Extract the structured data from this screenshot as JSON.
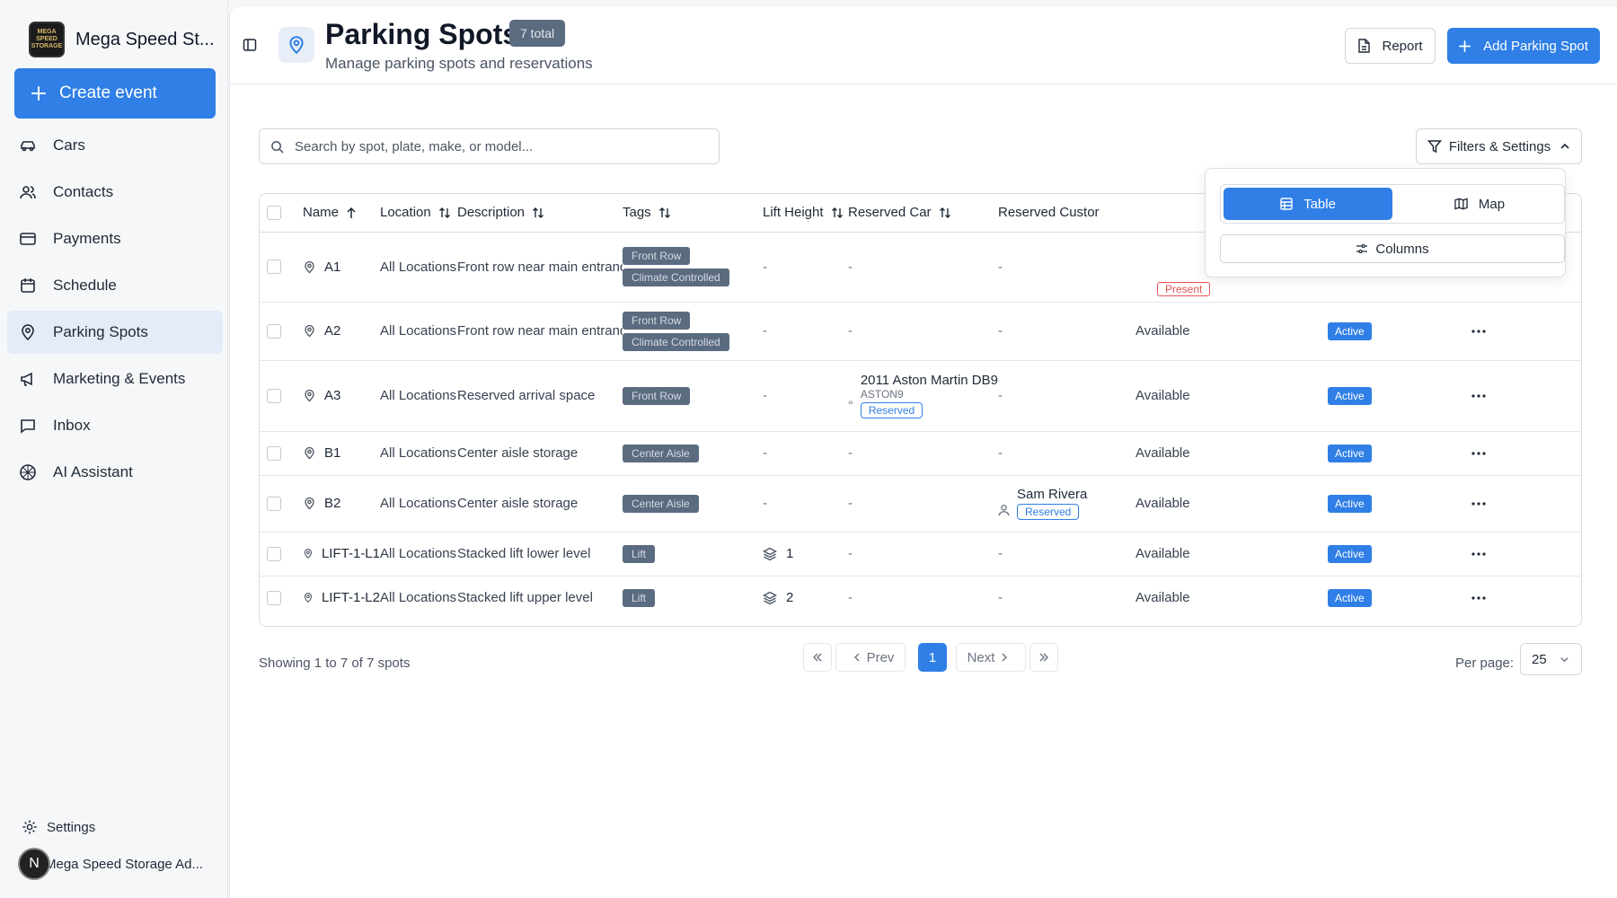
{
  "sidebar": {
    "brand_name": "Mega Speed St...",
    "logo_text": "MEGA SPEED STORAGE",
    "create_label": "Create event",
    "items": [
      {
        "label": "Cars",
        "icon": "car-icon"
      },
      {
        "label": "Contacts",
        "icon": "users-icon"
      },
      {
        "label": "Payments",
        "icon": "credit-card-icon"
      },
      {
        "label": "Schedule",
        "icon": "calendar-icon"
      },
      {
        "label": "Parking Spots",
        "icon": "map-pin-icon",
        "active": true
      },
      {
        "label": "Marketing & Events",
        "icon": "megaphone-icon"
      },
      {
        "label": "Inbox",
        "icon": "message-square-icon"
      },
      {
        "label": "AI Assistant",
        "icon": "ai-icon"
      }
    ],
    "settings_label": "Settings",
    "user_initial": "N",
    "user_name": "Mega Speed Storage Ad..."
  },
  "header": {
    "title": "Parking Spots",
    "count": "7 total",
    "subtitle": "Manage parking spots and reservations",
    "report_label": "Report",
    "add_label": "Add Parking Spot"
  },
  "search": {
    "placeholder": "Search by spot, plate, make, or model..."
  },
  "filters": {
    "label": "Filters & Settings",
    "view_table": "Table",
    "view_map": "Map",
    "columns_label": "Columns"
  },
  "table": {
    "columns": [
      "Name",
      "Location",
      "Description",
      "Tags",
      "Lift Height",
      "Reserved Car",
      "Reserved Custor"
    ],
    "rows": [
      {
        "name": "A1",
        "location": "All Locations",
        "description": "Front row near main entrance",
        "tags": [
          "Front Row",
          "Climate Controlled"
        ],
        "lift": "-",
        "car": "-",
        "customer": "-",
        "availability": "Present",
        "status": ""
      },
      {
        "name": "A2",
        "location": "All Locations",
        "description": "Front row near main entrance",
        "tags": [
          "Front Row",
          "Climate Controlled"
        ],
        "lift": "-",
        "car": "-",
        "customer": "-",
        "availability": "Available",
        "status": "Active"
      },
      {
        "name": "A3",
        "location": "All Locations",
        "description": "Reserved arrival space",
        "tags": [
          "Front Row"
        ],
        "lift": "-",
        "car": "2011 Aston Martin DB9",
        "car_plate": "ASTON9",
        "car_badge": "Reserved",
        "customer": "-",
        "availability": "Available",
        "status": "Active"
      },
      {
        "name": "B1",
        "location": "All Locations",
        "description": "Center aisle storage",
        "tags": [
          "Center Aisle"
        ],
        "lift": "-",
        "car": "-",
        "customer": "-",
        "availability": "Available",
        "status": "Active"
      },
      {
        "name": "B2",
        "location": "All Locations",
        "description": "Center aisle storage",
        "tags": [
          "Center Aisle"
        ],
        "lift": "-",
        "car": "-",
        "customer": "Sam Rivera",
        "customer_badge": "Reserved",
        "availability": "Available",
        "status": "Active"
      },
      {
        "name": "LIFT-1-L1",
        "location": "All Locations",
        "description": "Stacked lift lower level",
        "tags": [
          "Lift"
        ],
        "lift": "1",
        "car": "-",
        "customer": "-",
        "availability": "Available",
        "status": "Active"
      },
      {
        "name": "LIFT-1-L2",
        "location": "All Locations",
        "description": "Stacked lift upper level",
        "tags": [
          "Lift"
        ],
        "lift": "2",
        "car": "-",
        "customer": "-",
        "availability": "Available",
        "status": "Active"
      }
    ]
  },
  "pagination": {
    "showing": "Showing 1 to 7 of 7 spots",
    "prev": "Prev",
    "next": "Next",
    "current_page": "1",
    "per_page_label": "Per page:",
    "per_page": "25"
  },
  "colors": {
    "accent": "#2f7fe6",
    "tag": "#5b6b80",
    "danger": "#e55353"
  }
}
